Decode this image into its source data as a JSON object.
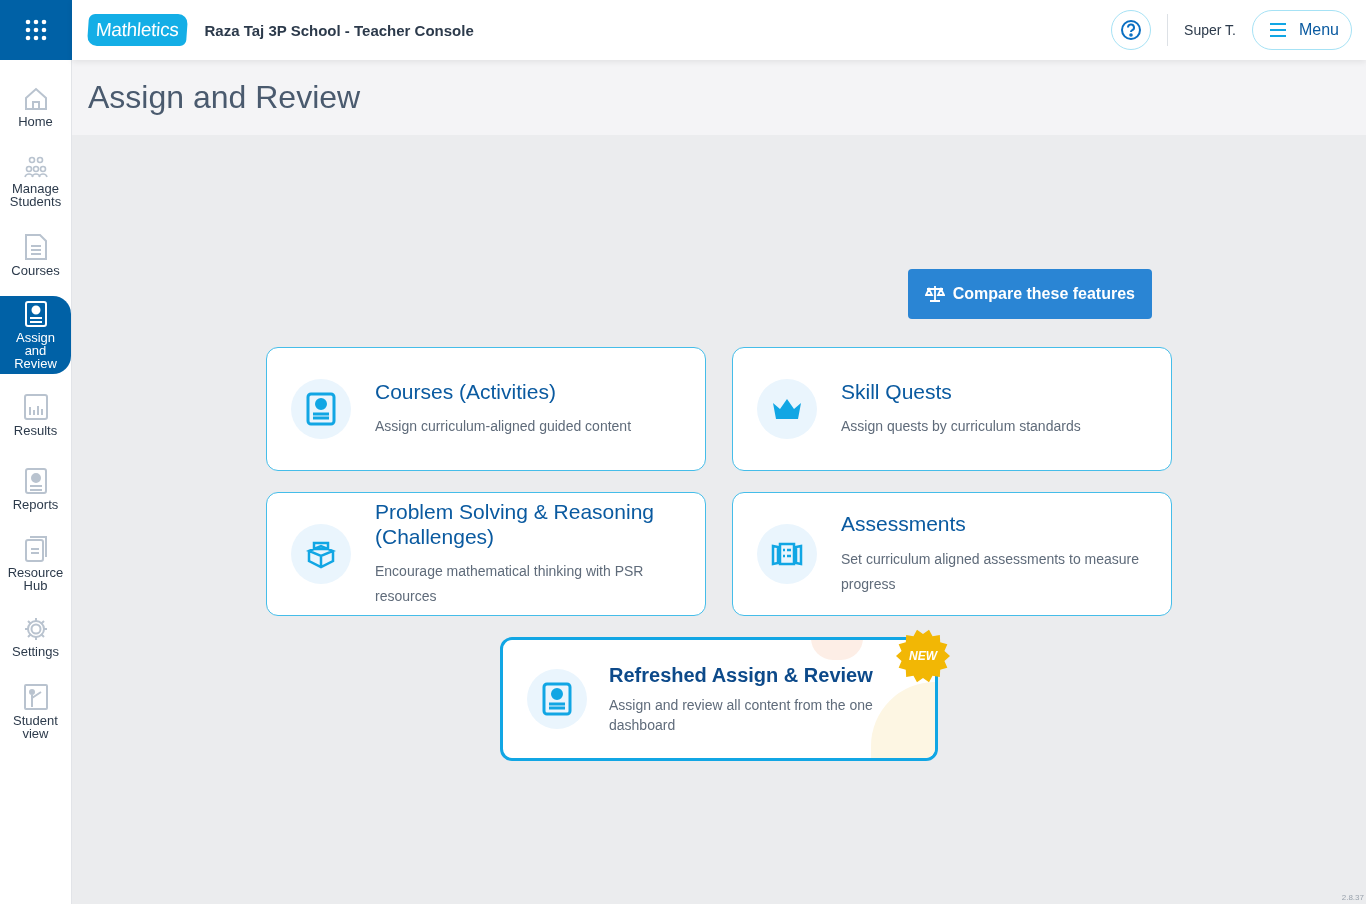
{
  "header": {
    "logo": "Mathletics",
    "school": "Raza Taj 3P School - Teacher Console",
    "user": "Super T.",
    "menu": "Menu"
  },
  "sidebar": {
    "items": [
      {
        "label": "Home",
        "selected": false
      },
      {
        "label": "Manage Students",
        "selected": false
      },
      {
        "label": "Courses",
        "selected": false
      },
      {
        "label": "Assign and Review",
        "selected": true
      },
      {
        "label": "Results",
        "selected": false
      },
      {
        "label": "Reports",
        "selected": false
      },
      {
        "label": "Resource Hub",
        "selected": false
      },
      {
        "label": "Settings",
        "selected": false
      },
      {
        "label": "Student view",
        "selected": false
      }
    ]
  },
  "page_title": "Assign and Review",
  "compare_button": "Compare these features",
  "cards": [
    {
      "title": "Courses (Activities)",
      "description": "Assign curriculum-aligned guided content"
    },
    {
      "title": "Skill Quests",
      "description": "Assign quests by curriculum standards"
    },
    {
      "title": "Problem Solving & Reasoning (Challenges)",
      "description": "Encourage mathematical thinking with PSR resources"
    },
    {
      "title": "Assessments",
      "description": "Set curriculum aligned assessments to measure progress"
    }
  ],
  "featured_card": {
    "title": "Refreshed Assign & Review",
    "description": "Assign and review all content from the one dashboard",
    "badge": "NEW"
  },
  "version": "2.8.37"
}
